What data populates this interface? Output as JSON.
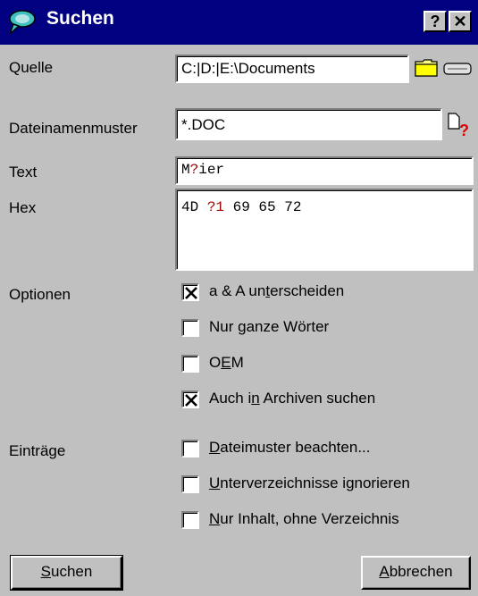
{
  "window": {
    "title": "Suchen",
    "help": "?",
    "close": "✕"
  },
  "labels": {
    "source": "Quelle",
    "pattern": "Dateinamenmuster",
    "text": "Text",
    "hex": "Hex",
    "options": "Optionen",
    "entries": "Einträge"
  },
  "fields": {
    "source": "C:|D:|E:\\Documents",
    "pattern": "*.DOC",
    "text_a": "M",
    "text_wild": "?",
    "text_b": "ier",
    "hex_a": "4D ",
    "hex_wild": "?1",
    "hex_b": " 69 65 72"
  },
  "options": [
    {
      "pre": "a & A un",
      "ul": "t",
      "post": "erscheiden",
      "checked": true
    },
    {
      "pre": "Nur ",
      "ul": "g",
      "post": "anze Wörter",
      "checked": false
    },
    {
      "pre": "O",
      "ul": "E",
      "post": "M",
      "checked": false
    },
    {
      "pre": "Auch i",
      "ul": "n",
      "post": " Archiven suchen",
      "checked": true
    }
  ],
  "entries": [
    {
      "pre": "",
      "ul": "D",
      "post": "ateimuster beachten...",
      "checked": false
    },
    {
      "pre": "",
      "ul": "U",
      "post": "nterverzeichnisse ignorieren",
      "checked": false
    },
    {
      "pre": "",
      "ul": "N",
      "post": "ur Inhalt, ohne Verzeichnis",
      "checked": false
    }
  ],
  "buttons": {
    "search_ul": "S",
    "search_rest": "uchen",
    "cancel_ul": "A",
    "cancel_rest": "bbrechen"
  },
  "colors": {
    "titlebar": "#000080",
    "dialog": "#c0c0c0",
    "wildcard": "#a00000"
  },
  "icons": [
    "search-window-icon",
    "help-icon",
    "close-icon",
    "folder-icon",
    "drive-icon",
    "pattern-help-icon",
    "check-mark-icon"
  ]
}
